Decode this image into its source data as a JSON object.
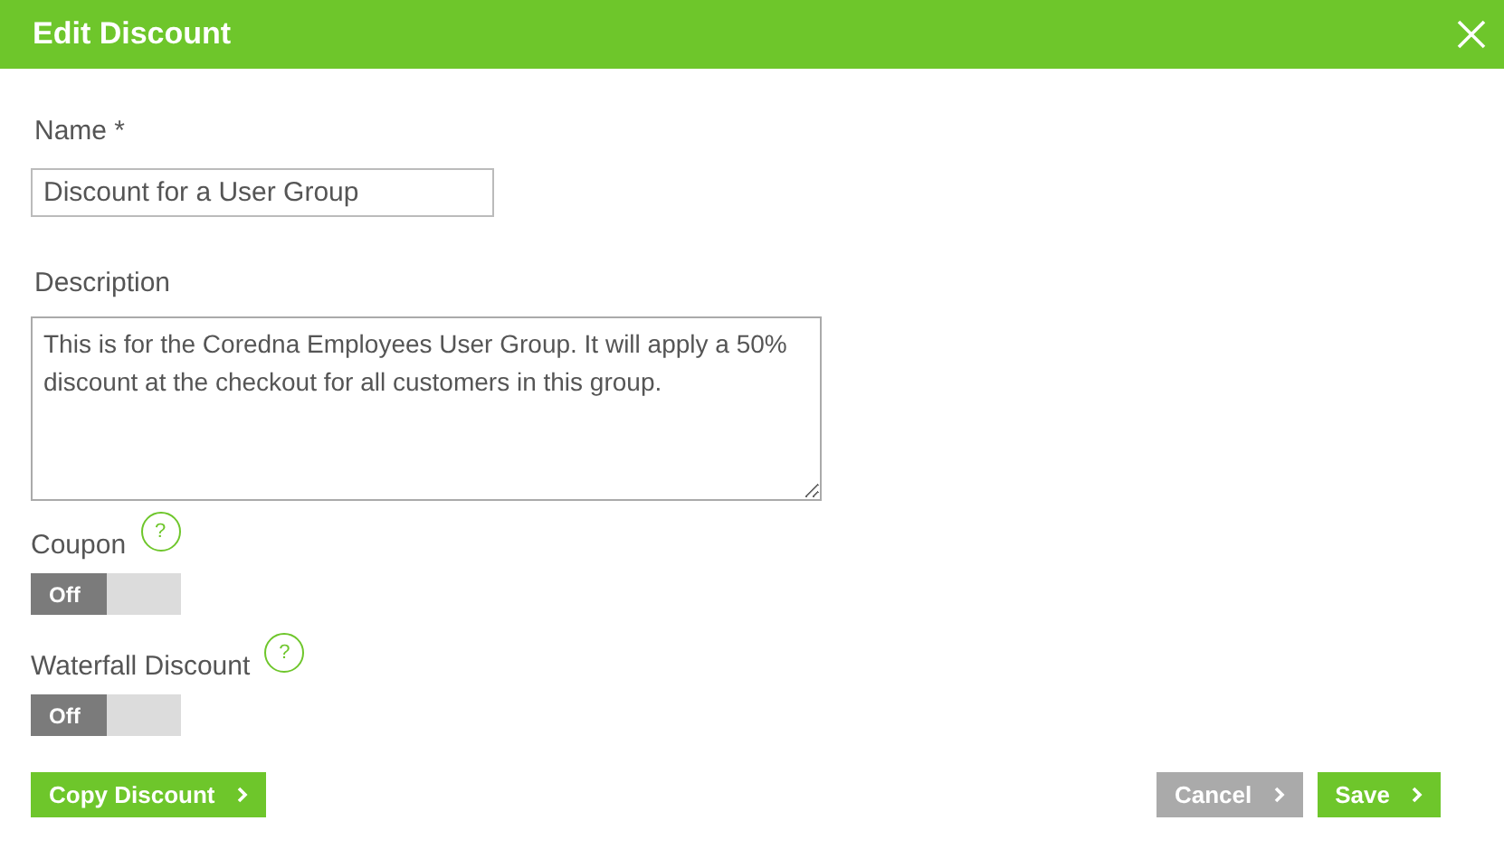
{
  "window": {
    "title": "Edit Discount"
  },
  "name_field": {
    "label": "Name *",
    "value": "Discount for a User Group"
  },
  "description_field": {
    "label": "Description",
    "value": "This is for the Coredna Employees User Group. It will apply a 50% discount at the checkout for all customers in this group."
  },
  "toggles": [
    {
      "label": "Coupon",
      "state_text": "Off",
      "on": false,
      "help": "?"
    },
    {
      "label": "Waterfall Discount",
      "state_text": "Off",
      "on": false,
      "help": "?"
    }
  ],
  "buttons": {
    "copy": "Copy Discount",
    "cancel": "Cancel",
    "save": "Save"
  }
}
